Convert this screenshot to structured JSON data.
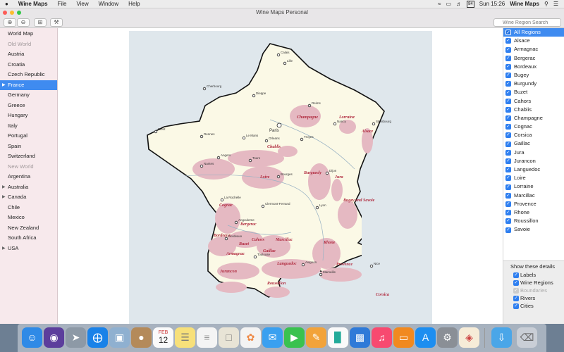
{
  "menubar": {
    "apple": "",
    "app_name": "Wine Maps",
    "menus": [
      "File",
      "View",
      "Window",
      "Help"
    ],
    "battery": "84",
    "clock": "Sun 15:26",
    "app_right": "Wine Maps"
  },
  "window": {
    "title": "Wine Maps Personal"
  },
  "toolbar": {
    "search_placeholder": "Wine Region Search"
  },
  "sidebar": {
    "top_item": "World Map",
    "groups": [
      {
        "header": "Old World",
        "items": [
          {
            "label": "Austria"
          },
          {
            "label": "Croatia"
          },
          {
            "label": "Czech Republic"
          },
          {
            "label": "France",
            "selected": true,
            "expandable": true
          },
          {
            "label": "Germany"
          },
          {
            "label": "Greece"
          },
          {
            "label": "Hungary"
          },
          {
            "label": "Italy"
          },
          {
            "label": "Portugal"
          },
          {
            "label": "Spain"
          },
          {
            "label": "Switzerland"
          }
        ]
      },
      {
        "header": "New World",
        "items": [
          {
            "label": "Argentina"
          },
          {
            "label": "Australia",
            "expandable": true
          },
          {
            "label": "Canada",
            "expandable": true
          },
          {
            "label": "Chile"
          },
          {
            "label": "Mexico"
          },
          {
            "label": "New Zealand"
          },
          {
            "label": "South Africa"
          },
          {
            "label": "USA",
            "expandable": true
          }
        ]
      }
    ]
  },
  "regions": {
    "all_label": "All Regions",
    "items": [
      "Alsace",
      "Armagnac",
      "Bergerac",
      "Bordeaux",
      "Bugey",
      "Burgundy",
      "Buzet",
      "Cahors",
      "Chablis",
      "Champagne",
      "Cognac",
      "Corsica",
      "Gaillac",
      "Jura",
      "Jurancon",
      "Languedoc",
      "Loire",
      "Lorraine",
      "Marcillac",
      "Provence",
      "Rhone",
      "Roussillon",
      "Savoie"
    ]
  },
  "details": {
    "header": "Show these details",
    "items": [
      {
        "label": "Labels",
        "checked": true
      },
      {
        "label": "Wine Regions",
        "checked": true
      },
      {
        "label": "Boundaries",
        "checked": true,
        "disabled": true
      },
      {
        "label": "Rivers",
        "checked": true
      },
      {
        "label": "Cities",
        "checked": true
      }
    ]
  },
  "map": {
    "cities": [
      "Calais",
      "Lille",
      "Dieppe",
      "Cherbourg",
      "Reims",
      "Paris",
      "Nancy",
      "Strasbourg",
      "Brest",
      "Rennes",
      "Le Mans",
      "Orleans",
      "Troyes",
      "Angers",
      "Tours",
      "Nantes",
      "Dijon",
      "Bourges",
      "La Rochelle",
      "Clermont-Ferrand",
      "Lyon",
      "Angouleme",
      "Bordeaux",
      "Toulouse",
      "Avignon",
      "Marseille",
      "Nice"
    ],
    "regions": [
      "Champagne",
      "Lorraine",
      "Alsace",
      "Chablis",
      "Loire",
      "Burgundy",
      "Jura",
      "Bugey and Savoie",
      "Cognac",
      "Bergerac",
      "Bordeaux",
      "Cahors",
      "Marcillac",
      "Buzet",
      "Gaillac",
      "Rhone",
      "Armagnac",
      "Languedoc",
      "Provence",
      "Jurancon",
      "Roussillon",
      "Corsica"
    ]
  },
  "colors": {
    "accent": "#3f8bf0",
    "sidebar": "#f7e9ec",
    "land": "#fbf9e6",
    "sea": "#dfe7ec",
    "wine": "#e5b9c2",
    "label": "#b02a3e"
  },
  "dock": {
    "calendar_month": "FEB",
    "calendar_day": "12"
  }
}
